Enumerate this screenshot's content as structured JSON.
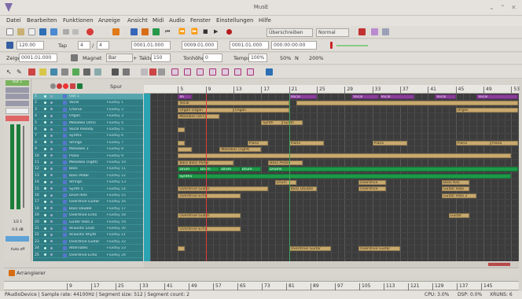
{
  "window": {
    "title": "MusE",
    "controls": [
      "⌄",
      "⌃",
      "✕"
    ]
  },
  "menubar": [
    "Datei",
    "Bearbeiten",
    "Funktionen",
    "Anzeige",
    "Ansicht",
    "Midi",
    "Audio",
    "Fenster",
    "Einstellungen",
    "Hilfe"
  ],
  "toolbar1": {
    "record_mode": "Überschreiben",
    "loop_mode": "Normal"
  },
  "toolbar2": {
    "tempo": "120.00",
    "tap_label": "Tap",
    "sig_num": "4",
    "sig_den": "4",
    "pos_bbt": "0001.01.000",
    "left_marker": "0009.01.000",
    "right_marker": "0001.01.000",
    "time_smpte": "000:00:00:00"
  },
  "toolbar3": {
    "cursor_label": "Zeiger",
    "cursor_value": "0001.01.000",
    "magnet_label": "Magnet",
    "magnet_value": "Bar",
    "pitch_label": "Takte",
    "pitch_value": "150",
    "pitch_prefix": "+",
    "tonhoehe_label": "Tonhöhe",
    "tonhoehe_value": "0",
    "tempo_label": "Tempo",
    "tempo_value": "100%",
    "zoom_a": "50%",
    "zoom_n": "N",
    "zoom_b": "200%"
  },
  "left_strip": {
    "label_a": "Out 1",
    "label_b": "1/2 1",
    "label_c": "0.0 dB",
    "label_d": "Auto off"
  },
  "track_header": {
    "track_col": "Spur",
    "out_label": "Out 1"
  },
  "tracks": [
    {
      "n": "1",
      "name": "Out 1",
      "port": ""
    },
    {
      "n": "2",
      "name": "Vocal",
      "port": "FluidSy 1"
    },
    {
      "n": "3",
      "name": "Chorus",
      "port": "FluidSy 2"
    },
    {
      "n": "4",
      "name": "Organ",
      "port": "FluidSy 3"
    },
    {
      "n": "5",
      "name": "Melodies (strs)",
      "port": "FluidSy 4"
    },
    {
      "n": "6",
      "name": "Vocal melody",
      "port": "FluidSy 5"
    },
    {
      "n": "7",
      "name": "Synth1",
      "port": "FluidSy 6"
    },
    {
      "n": "8",
      "name": "Strings",
      "port": "FluidSy 7"
    },
    {
      "n": "9",
      "name": "Melodies 1",
      "port": "FluidSy 8"
    },
    {
      "n": "10",
      "name": "Piano",
      "port": "FluidSy 9"
    },
    {
      "n": "11",
      "name": "Melodies (right)",
      "port": "FluidSy 10"
    },
    {
      "n": "12",
      "name": "Bass",
      "port": "FluidSy 11"
    },
    {
      "n": "13",
      "name": "Bass Pedal",
      "port": "FluidSy 12"
    },
    {
      "n": "14",
      "name": "Strings",
      "port": "FluidSy 13"
    },
    {
      "n": "15",
      "name": "Synth 5",
      "port": "FluidSy 14"
    },
    {
      "n": "16",
      "name": "Drum Kits",
      "port": "FluidSy 15"
    },
    {
      "n": "17",
      "name": "Overdrive Guitar",
      "port": "FluidSy 16"
    },
    {
      "n": "18",
      "name": "Bass Double",
      "port": "FluidSy 17"
    },
    {
      "n": "19",
      "name": "Overdrive Echo",
      "port": "FluidSy 18"
    },
    {
      "n": "20",
      "name": "Guitar Halo 2",
      "port": "FluidSy 19"
    },
    {
      "n": "21",
      "name": "Acoustic Lead",
      "port": "FluidSy 20"
    },
    {
      "n": "22",
      "name": "Acoustic Rhyth",
      "port": "FluidSy 21"
    },
    {
      "n": "23",
      "name": "Overdrive Guitar",
      "port": "FluidSy 22"
    },
    {
      "n": "24",
      "name": "Alternates",
      "port": "FluidSy 23"
    },
    {
      "n": "25",
      "name": "Overdrive Echo",
      "port": "FluidSy 24"
    }
  ],
  "ruler_top": [
    "5",
    "9",
    "13",
    "17",
    "21",
    "25",
    "29",
    "33",
    "37",
    "41",
    "45",
    "49",
    "53"
  ],
  "ruler_bottom": [
    "9",
    "17",
    "25",
    "33",
    "41",
    "49",
    "57",
    "65",
    "73",
    "81",
    "89",
    "97",
    "105",
    "113",
    "121",
    "129",
    "137",
    "145"
  ],
  "parts": [
    {
      "row": 0,
      "bar": 5,
      "w": 2,
      "c": "pur",
      "t": "Vo"
    },
    {
      "row": 0,
      "bar": 21,
      "w": 4,
      "c": "pur",
      "t": "Vocal"
    },
    {
      "row": 0,
      "bar": 30,
      "w": 4,
      "c": "pur",
      "t": "Vocal"
    },
    {
      "row": 0,
      "bar": 34,
      "w": 5,
      "c": "pur",
      "t": "Vocal"
    },
    {
      "row": 0,
      "bar": 42,
      "w": 3,
      "c": "pur",
      "t": "Vocal"
    },
    {
      "row": 0,
      "bar": 48,
      "w": 6,
      "c": "pur",
      "t": "Vocal"
    },
    {
      "row": 1,
      "bar": 5,
      "w": 16,
      "c": "tan",
      "t": "Vocal"
    },
    {
      "row": 1,
      "bar": 22,
      "w": 32,
      "c": "tan",
      "t": ""
    },
    {
      "row": 2,
      "bar": 5,
      "w": 8,
      "c": "tan",
      "t": "Organ   Organ"
    },
    {
      "row": 2,
      "bar": 13,
      "w": 8,
      "c": "tan",
      "t": "Organ"
    },
    {
      "row": 2,
      "bar": 45,
      "w": 9,
      "c": "tan",
      "t": "Organ"
    },
    {
      "row": 3,
      "bar": 5,
      "w": 6,
      "c": "tan",
      "t": "Melodies (strs)"
    },
    {
      "row": 4,
      "bar": 17,
      "w": 3,
      "c": "tan",
      "t": "Synth"
    },
    {
      "row": 4,
      "bar": 20,
      "w": 3,
      "c": "tan",
      "t": "Synth"
    },
    {
      "row": 5,
      "bar": 5,
      "w": 1,
      "c": "tan",
      "t": ""
    },
    {
      "row": 7,
      "bar": 5,
      "w": 1,
      "c": "tan",
      "t": ""
    },
    {
      "row": 7,
      "bar": 15,
      "w": 3,
      "c": "tan",
      "t": "Piano"
    },
    {
      "row": 7,
      "bar": 21,
      "w": 5,
      "c": "tan",
      "t": "Piano"
    },
    {
      "row": 7,
      "bar": 33,
      "w": 5,
      "c": "tan",
      "t": "Piano"
    },
    {
      "row": 7,
      "bar": 45,
      "w": 5,
      "c": "tan",
      "t": "Piano"
    },
    {
      "row": 7,
      "bar": 50,
      "w": 4,
      "c": "tan",
      "t": "Piano"
    },
    {
      "row": 8,
      "bar": 5,
      "w": 2,
      "c": "tan",
      "t": ""
    },
    {
      "row": 8,
      "bar": 11,
      "w": 6,
      "c": "tan",
      "t": "Melodies (right)"
    },
    {
      "row": 9,
      "bar": 5,
      "w": 48,
      "c": "tan",
      "t": ""
    },
    {
      "row": 10,
      "bar": 5,
      "w": 8,
      "c": "tan",
      "t": "Bass Bass Pedal"
    },
    {
      "row": 10,
      "bar": 18,
      "w": 5,
      "c": "tan",
      "t": "Bass Pedal"
    },
    {
      "row": 11,
      "bar": 5,
      "w": 3,
      "c": "grn",
      "t": "Drum"
    },
    {
      "row": 11,
      "bar": 8,
      "w": 3,
      "c": "grn",
      "t": "Drum"
    },
    {
      "row": 11,
      "bar": 11,
      "w": 3,
      "c": "grn",
      "t": "Drum"
    },
    {
      "row": 11,
      "bar": 14,
      "w": 3,
      "c": "grn",
      "t": "Drum"
    },
    {
      "row": 11,
      "bar": 18,
      "w": 36,
      "c": "grn",
      "t": "Drums"
    },
    {
      "row": 12,
      "bar": 5,
      "w": 48,
      "c": "grn",
      "t": "Synth5"
    },
    {
      "row": 13,
      "bar": 19,
      "w": 3,
      "c": "tan",
      "t": "Drum"
    },
    {
      "row": 13,
      "bar": 31,
      "w": 4,
      "c": "tan",
      "t": "Overdrive"
    },
    {
      "row": 13,
      "bar": 43,
      "w": 4,
      "c": "tan",
      "t": "Bass Kits"
    },
    {
      "row": 14,
      "bar": 5,
      "w": 13,
      "c": "tan",
      "t": "Overdrive Guitar"
    },
    {
      "row": 14,
      "bar": 21,
      "w": 4,
      "c": "tan",
      "t": "Bass Double"
    },
    {
      "row": 14,
      "bar": 31,
      "w": 4,
      "c": "tan",
      "t": "Overdrive"
    },
    {
      "row": 14,
      "bar": 43,
      "w": 4,
      "c": "tan",
      "t": "Guitar Halo"
    },
    {
      "row": 15,
      "bar": 5,
      "w": 9,
      "c": "tan",
      "t": "Overdrive Echo"
    },
    {
      "row": 15,
      "bar": 43,
      "w": 5,
      "c": "tan",
      "t": "Guitar Halo 2"
    },
    {
      "row": 18,
      "bar": 5,
      "w": 9,
      "c": "tan",
      "t": "Overdrive Guitar"
    },
    {
      "row": 18,
      "bar": 44,
      "w": 3,
      "c": "tan",
      "t": "Guitar"
    },
    {
      "row": 20,
      "bar": 5,
      "w": 9,
      "c": "tan",
      "t": "Overdrive Echo"
    },
    {
      "row": 23,
      "bar": 5,
      "w": 1,
      "c": "tan",
      "t": ""
    },
    {
      "row": 23,
      "bar": 21,
      "w": 6,
      "c": "tan",
      "t": "Overdrive Guitar"
    },
    {
      "row": 23,
      "bar": 31,
      "w": 6,
      "c": "tan",
      "t": "Overdrive Guitar"
    }
  ],
  "tab": "Arrangierer",
  "status": {
    "left": "PAudioDevice | Sample rate: 44100Hz | Segment size: 512 | Segment count: 2",
    "cpu": "CPU: 3.0%",
    "dsp": "DSP: 0.0%",
    "xruns": "XRUNS: 6"
  }
}
